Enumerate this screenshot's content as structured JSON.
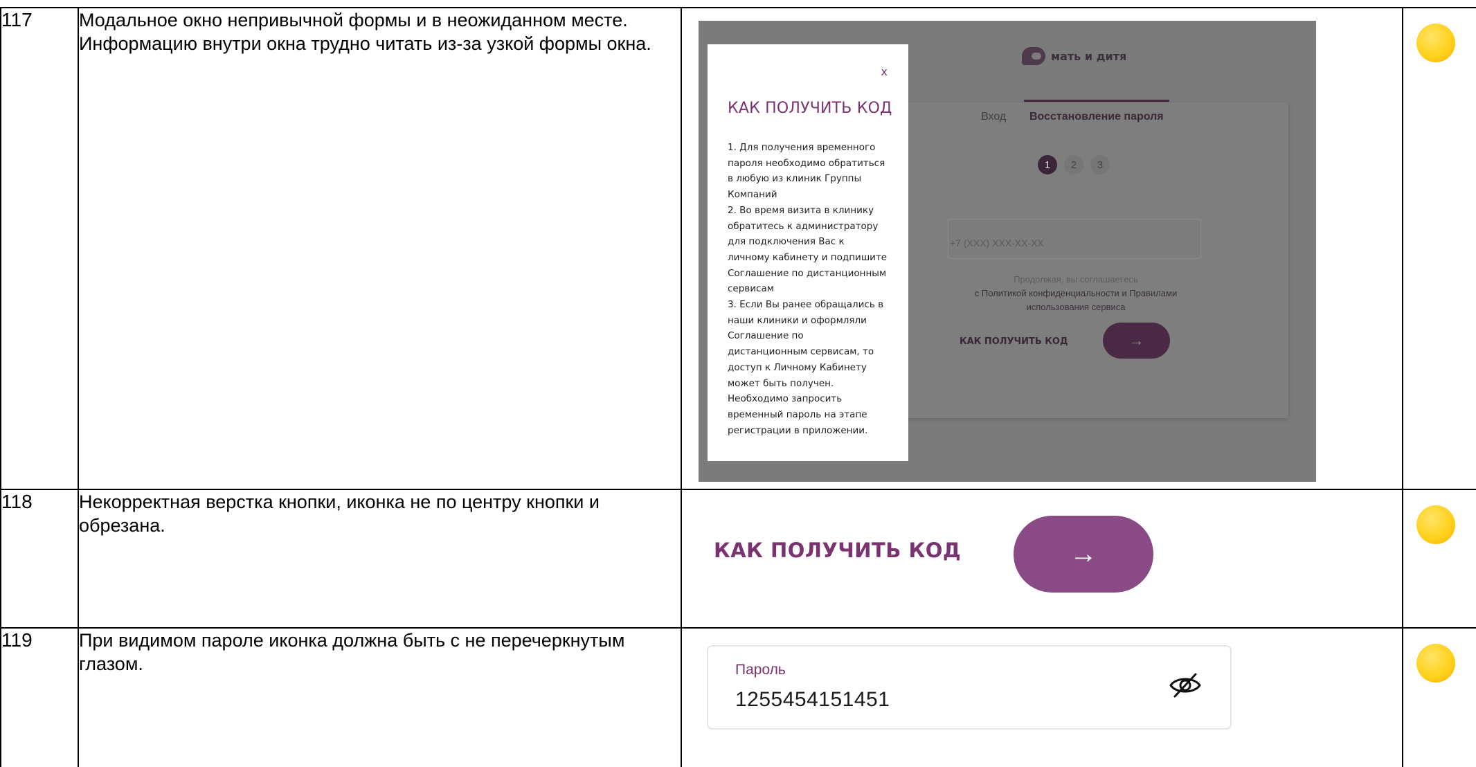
{
  "rows": [
    {
      "number": "117",
      "description": "Модальное окно непривычной формы и в неожиданном месте. Информацию внутри окна трудно читать из-за узкой формы окна.",
      "severity_color": "#ffd21e"
    },
    {
      "number": "118",
      "description": "Некорректная верстка кнопки, иконка не по центру кнопки и обрезана.",
      "severity_color": "#ffd21e"
    },
    {
      "number": "119",
      "description": "При видимом пароле иконка должна быть с не перечеркнутым глазом.",
      "severity_color": "#ffd21e"
    }
  ],
  "shot117": {
    "logo_text": "мать и дитя",
    "tab_login": "Вход",
    "tab_recover": "Восстановление пароля",
    "steps": [
      "1",
      "2",
      "3"
    ],
    "phone_placeholder": "+7 (XXX) XXX-XX-XX",
    "consent_prefix": "Продолжая, вы соглашаетесь",
    "consent_link_line": "с Политикой конфиденциальности и Правилами",
    "consent_link_line2": "использования сервиса",
    "how_link": "КАК ПОЛУЧИТЬ КОД",
    "next_arrow": "→",
    "modal": {
      "close": "x",
      "title": "КАК ПОЛУЧИТЬ КОД",
      "body": "1. Для получения временного\nпароля необходимо обратиться\nв любую из клиник Группы\nКомпаний\n2. Во время визита в клинику\nобратитесь к администратору\nдля подключения Вас к\nличному кабинету и подпишите\nСоглашение по дистанционным\nсервисам\n3. Если Вы ранее обращались в\nнаши клиники и оформляли\nСоглашение по\nдистанционным сервисам, то\nдоступ к Личному Кабинету\nможет быть получен.\nНеобходимо запросить\nвременный пароль на этапе\nрегистрации в приложении."
    }
  },
  "shot118": {
    "link": "КАК ПОЛУЧИТЬ КОД",
    "arrow": "→"
  },
  "shot119": {
    "label": "Пароль",
    "value": "1255454151451",
    "icon": "eye-crossed-icon"
  }
}
